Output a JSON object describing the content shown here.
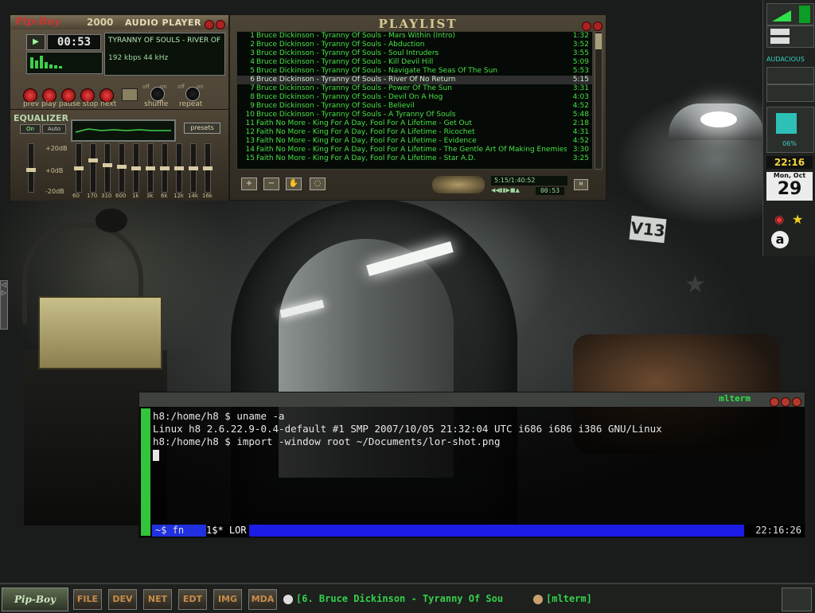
{
  "player": {
    "logo": "Pip-Boy",
    "year": "2000",
    "name": "AUDIO PLAYER",
    "time": "00:53",
    "track": "TYRANNY OF SOULS - RIVER OF NO",
    "bitrate": "192 kbps  44 kHz",
    "controls_label": "prev play pause stop next",
    "shuffle_label": "shuffle",
    "repeat_label": "repeat",
    "off_label": "off",
    "on_label": "on"
  },
  "equalizer": {
    "title": "EQUALIZER",
    "on_label": "On",
    "auto_label": "Auto",
    "presets_label": "presets",
    "db_top": "+20dB",
    "db_mid": "+0dB",
    "db_bot": "-20dB",
    "freqs": [
      "60",
      "170",
      "310",
      "600",
      "1k",
      "3k",
      "6k",
      "12k",
      "14k",
      "16k"
    ]
  },
  "playlist": {
    "title": "PLAYLIST",
    "selected_index": 6,
    "items": [
      {
        "n": "1",
        "title": "Bruce Dickinson - Tyranny Of Souls - Mars Within (Intro)",
        "dur": "1:32"
      },
      {
        "n": "2",
        "title": "Bruce Dickinson - Tyranny Of Souls - Abduction",
        "dur": "3:52"
      },
      {
        "n": "3",
        "title": "Bruce Dickinson - Tyranny Of Souls - Soul Intruders",
        "dur": "3:55"
      },
      {
        "n": "4",
        "title": "Bruce Dickinson - Tyranny Of Souls - Kill Devil Hill",
        "dur": "5:09"
      },
      {
        "n": "5",
        "title": "Bruce Dickinson - Tyranny Of Souls - Navigate The Seas Of The Sun",
        "dur": "5:53"
      },
      {
        "n": "6",
        "title": "Bruce Dickinson - Tyranny Of Souls - River Of No Return",
        "dur": "5:15"
      },
      {
        "n": "7",
        "title": "Bruce Dickinson - Tyranny Of Souls - Power Of The Sun",
        "dur": "3:31"
      },
      {
        "n": "8",
        "title": "Bruce Dickinson - Tyranny Of Souls - Devil On A Hog",
        "dur": "4:03"
      },
      {
        "n": "9",
        "title": "Bruce Dickinson - Tyranny Of Souls - Believil",
        "dur": "4:52"
      },
      {
        "n": "10",
        "title": "Bruce Dickinson - Tyranny Of Souls - A Tyranny Of Souls",
        "dur": "5:48"
      },
      {
        "n": "11",
        "title": "Faith No More - King For A Day, Fool For A Lifetime - Get Out",
        "dur": "2:18"
      },
      {
        "n": "12",
        "title": "Faith No More - King For A Day, Fool For A Lifetime - Ricochet",
        "dur": "4:31"
      },
      {
        "n": "13",
        "title": "Faith No More - King For A Day, Fool For A Lifetime - Evidence",
        "dur": "4:52"
      },
      {
        "n": "14",
        "title": "Faith No More - King For A Day, Fool For A Lifetime - The Gentle Art Of Making Enemies",
        "dur": "3:30"
      },
      {
        "n": "15",
        "title": "Faith No More - King For A Day, Fool For A Lifetime - Star A.D.",
        "dur": "3:25"
      }
    ],
    "info": "5:15/1:40:52",
    "mini_time": "00:53",
    "add_label": "+",
    "remove_label": "−",
    "menu_label": "M"
  },
  "dock": {
    "app_label": "AUDACIOUS",
    "percent": "06%",
    "clock": "22:16",
    "cal_day": "Mon, Oct",
    "cal_num": "29"
  },
  "wallpaper": {
    "sign": "V13"
  },
  "terminal": {
    "title": "mlterm",
    "lines": [
      "h8:/home/h8 $ uname -a",
      "Linux h8 2.6.22.9-0.4-default #1 SMP 2007/10/05 21:32:04 UTC i686 i686 i386 GNU/Linux",
      "h8:/home/h8 $ import -window root ~/Documents/lor-shot.png"
    ],
    "status_left": "~$ fn",
    "status_win": "1$* LOR",
    "status_time": "22:16:26"
  },
  "taskbar": {
    "logo": "Pip-Boy",
    "buttons": [
      "FILE",
      "DEV",
      "NET",
      "EDT",
      "IMG",
      "MDA"
    ],
    "task1": "[6. Bruce Dickinson - Tyranny Of Sou",
    "task2": "[mlterm]"
  },
  "colors": {
    "accent": "#33d14b",
    "player_bg": "#5d5343",
    "term_status": "#1c1ce6"
  }
}
